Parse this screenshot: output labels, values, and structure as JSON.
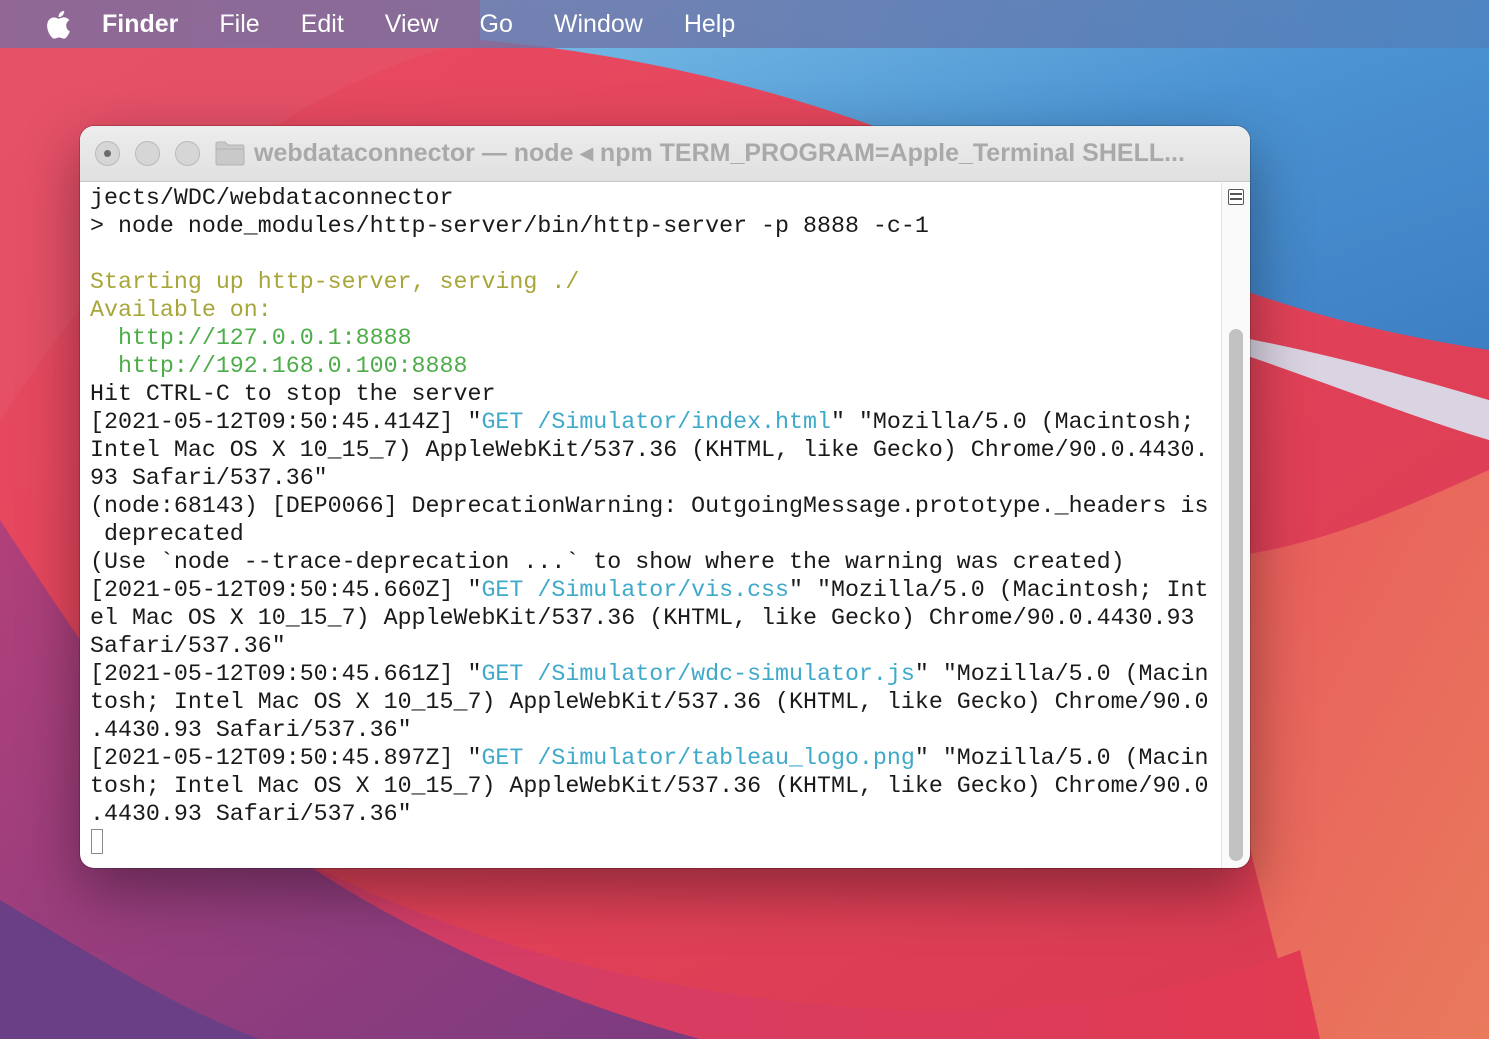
{
  "menubar": {
    "apple_icon": "apple-logo-icon",
    "app_name": "Finder",
    "items": [
      "File",
      "Edit",
      "View",
      "Go",
      "Window",
      "Help"
    ]
  },
  "terminal": {
    "title": "webdataconnector — node ◂ npm TERM_PROGRAM=Apple_Terminal SHELL...",
    "folder_icon": "folder-icon",
    "lines": [
      [
        {
          "t": "jects/WDC/webdataconnector"
        }
      ],
      [
        {
          "t": "> node node_modules/http-server/bin/http-server -p 8888 -c-1"
        }
      ],
      [
        {
          "t": ""
        }
      ],
      [
        {
          "t": "Starting up http-server, serving ./",
          "c": "yellow"
        }
      ],
      [
        {
          "t": "Available on:",
          "c": "yellow"
        }
      ],
      [
        {
          "t": "  http://127.0.0.1:8888",
          "c": "green"
        }
      ],
      [
        {
          "t": "  http://192.168.0.100:8888",
          "c": "green"
        }
      ],
      [
        {
          "t": "Hit CTRL-C to stop the server"
        }
      ],
      [
        {
          "t": "[2021-05-12T09:50:45.414Z] \""
        },
        {
          "t": "GET /Simulator/index.html",
          "c": "cyan"
        },
        {
          "t": "\" \"Mozilla/5.0 (Macintosh;"
        }
      ],
      [
        {
          "t": "Intel Mac OS X 10_15_7) AppleWebKit/537.36 (KHTML, like Gecko) Chrome/90.0.4430."
        }
      ],
      [
        {
          "t": "93 Safari/537.36\""
        }
      ],
      [
        {
          "t": "(node:68143) [DEP0066] DeprecationWarning: OutgoingMessage.prototype._headers is"
        }
      ],
      [
        {
          "t": " deprecated"
        }
      ],
      [
        {
          "t": "(Use `node --trace-deprecation ...` to show where the warning was created)"
        }
      ],
      [
        {
          "t": "[2021-05-12T09:50:45.660Z] \""
        },
        {
          "t": "GET /Simulator/vis.css",
          "c": "cyan"
        },
        {
          "t": "\" \"Mozilla/5.0 (Macintosh; Int"
        }
      ],
      [
        {
          "t": "el Mac OS X 10_15_7) AppleWebKit/537.36 (KHTML, like Gecko) Chrome/90.0.4430.93"
        }
      ],
      [
        {
          "t": "Safari/537.36\""
        }
      ],
      [
        {
          "t": "[2021-05-12T09:50:45.661Z] \""
        },
        {
          "t": "GET /Simulator/wdc-simulator.js",
          "c": "cyan"
        },
        {
          "t": "\" \"Mozilla/5.0 (Macin"
        }
      ],
      [
        {
          "t": "tosh; Intel Mac OS X 10_15_7) AppleWebKit/537.36 (KHTML, like Gecko) Chrome/90.0"
        }
      ],
      [
        {
          "t": ".4430.93 Safari/537.36\""
        }
      ],
      [
        {
          "t": "[2021-05-12T09:50:45.897Z] \""
        },
        {
          "t": "GET /Simulator/tableau_logo.png",
          "c": "cyan"
        },
        {
          "t": "\" \"Mozilla/5.0 (Macin"
        }
      ],
      [
        {
          "t": "tosh; Intel Mac OS X 10_15_7) AppleWebKit/537.36 (KHTML, like Gecko) Chrome/90.0"
        }
      ],
      [
        {
          "t": ".4430.93 Safari/537.36\""
        }
      ]
    ]
  },
  "colors": {
    "yellow": "#a8a63a",
    "green": "#4dad49",
    "cyan": "#3fa9c9"
  }
}
